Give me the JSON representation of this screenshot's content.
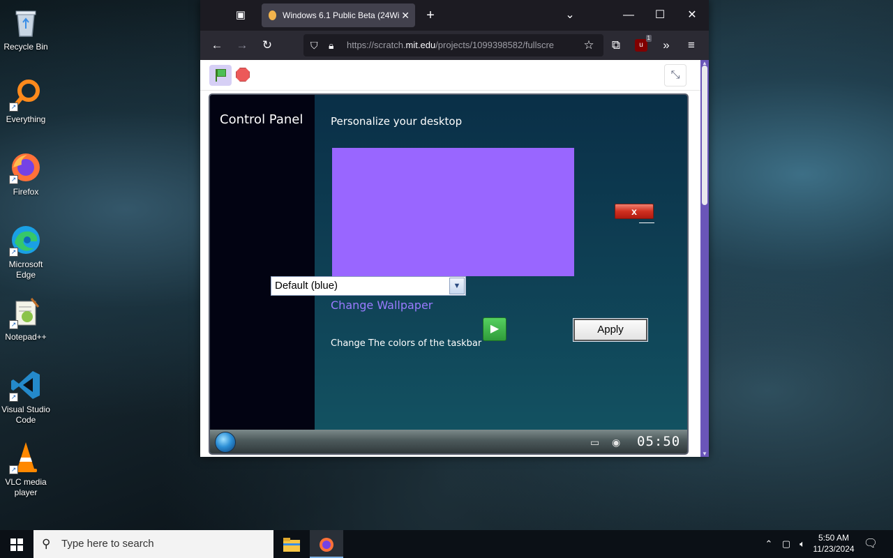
{
  "desktop": {
    "icons": [
      {
        "label": "Recycle Bin",
        "icon": "recycle-bin-icon"
      },
      {
        "label": "Everything",
        "icon": "everything-search-icon"
      },
      {
        "label": "Firefox",
        "icon": "firefox-icon"
      },
      {
        "label": "Microsoft Edge",
        "icon": "edge-icon"
      },
      {
        "label": "Notepad++",
        "icon": "notepadpp-icon"
      },
      {
        "label": "Visual Studio Code",
        "icon": "vscode-icon"
      },
      {
        "label": "VLC media player",
        "icon": "vlc-icon"
      }
    ]
  },
  "browser": {
    "tab_title": "Windows 6.1 Public Beta (24Wi",
    "url_prefix": "https://scratch.",
    "url_host": "mit.edu",
    "url_path": "/projects/1099398582/fullscre",
    "ublock_badge": "1",
    "colors": {
      "titlebar": "#1c1b22",
      "toolbar": "#2b2a33",
      "scrollbar": "#6a55b9"
    }
  },
  "stage": {
    "sidebar_title": "Control Panel",
    "heading": "Personalize your desktop",
    "preview_color": "#9966ff",
    "close_label": "x",
    "dropdown_value": "Default (blue)",
    "change_wallpaper": "Change Wallpaper",
    "apply_label": "Apply",
    "taskbar_colors_label": "Change The colors of the taskbar",
    "clock": "05:50"
  },
  "taskbar": {
    "search_placeholder": "Type here to search",
    "time": "5:50 AM",
    "date": "11/23/2024"
  }
}
